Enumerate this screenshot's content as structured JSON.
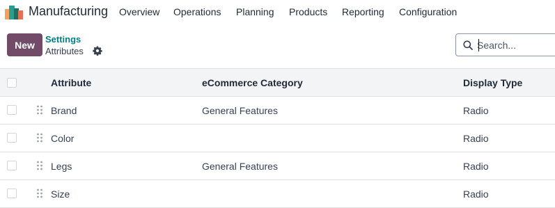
{
  "app": {
    "name": "Manufacturing",
    "menu": [
      "Overview",
      "Operations",
      "Planning",
      "Products",
      "Reporting",
      "Configuration"
    ]
  },
  "control_panel": {
    "new_label": "New",
    "breadcrumb_parent": "Settings",
    "breadcrumb_current": "Attributes",
    "search_placeholder": "Search..."
  },
  "table": {
    "columns": [
      "Attribute",
      "eCommerce Category",
      "Display Type"
    ],
    "rows": [
      {
        "attribute": "Brand",
        "category": "General Features",
        "display_type": "Radio"
      },
      {
        "attribute": "Color",
        "category": "",
        "display_type": "Radio"
      },
      {
        "attribute": "Legs",
        "category": "General Features",
        "display_type": "Radio"
      },
      {
        "attribute": "Size",
        "category": "",
        "display_type": "Radio"
      }
    ]
  },
  "colors": {
    "brand": "#714B67",
    "link": "#017e84",
    "header_bg": "#f3f4f6"
  }
}
